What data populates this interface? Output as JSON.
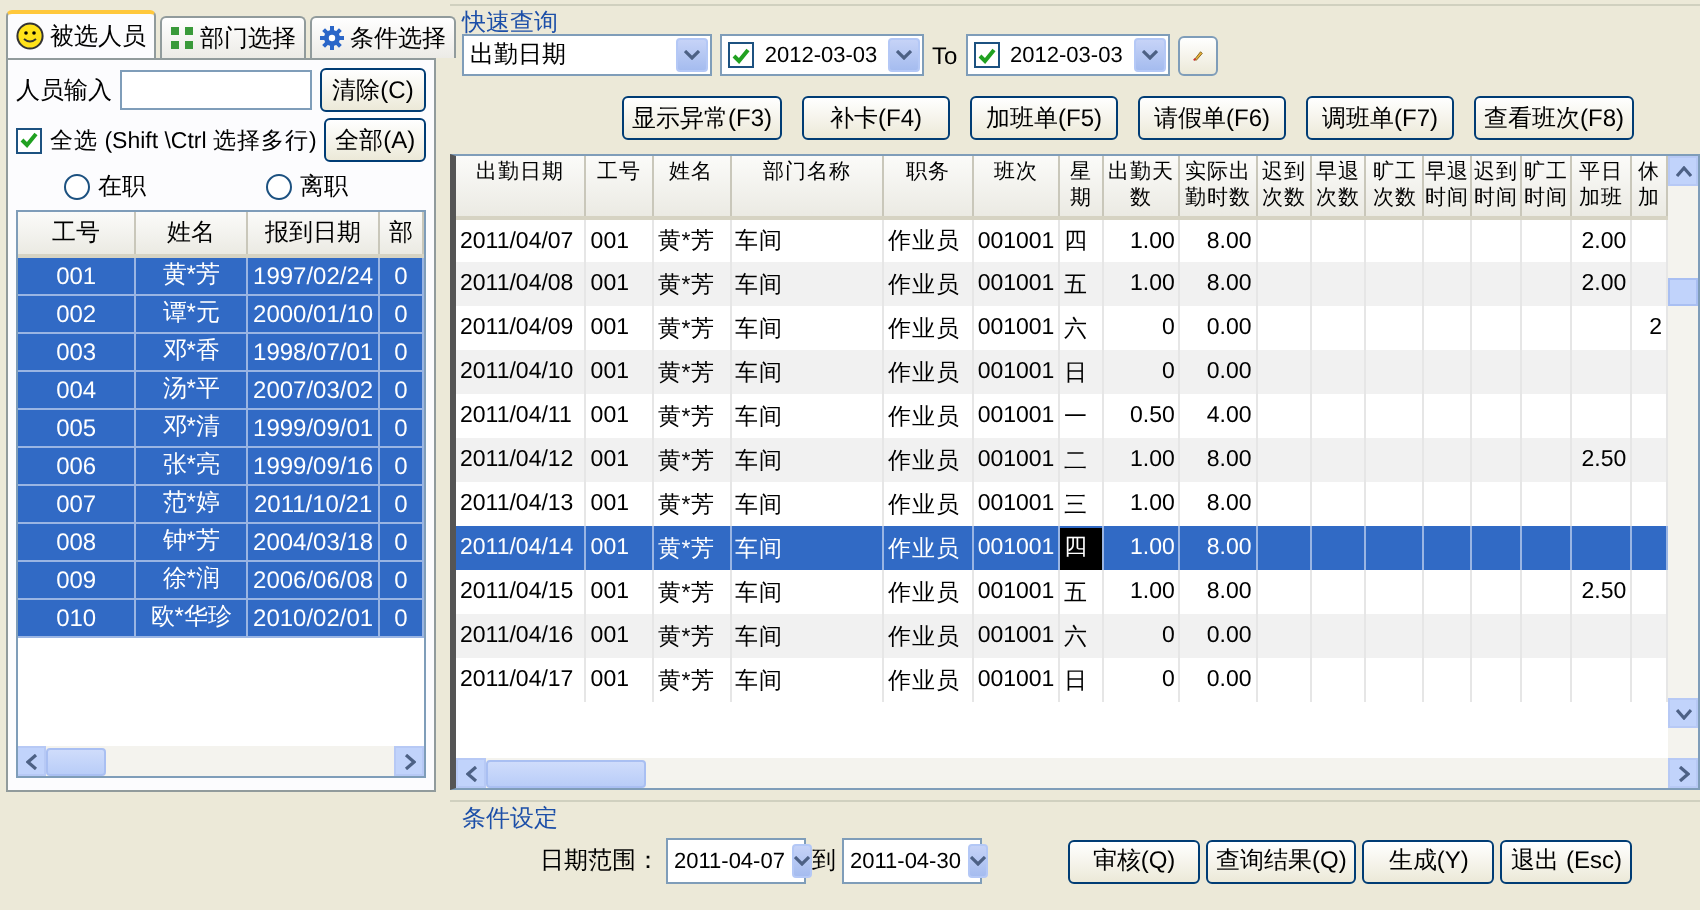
{
  "left_panel": {
    "tabs": [
      {
        "label": "被选人员",
        "selected": true
      },
      {
        "label": "部门选择",
        "selected": false
      },
      {
        "label": "条件选择",
        "selected": false
      }
    ],
    "person_input_label": "人员输入",
    "clear_button": "清除(C)",
    "all_button": "全部(A)",
    "select_all": {
      "label": "全选 (Shift \\Ctrl 选择多行)",
      "checked": true
    },
    "status_radios": [
      {
        "label": "在职",
        "selected": false
      },
      {
        "label": "离职",
        "selected": false
      }
    ],
    "table": {
      "columns": [
        "工号",
        "姓名",
        "报到日期",
        "部"
      ],
      "rows": [
        {
          "cells": [
            "001",
            "黄*芳",
            "1997/02/24",
            "0"
          ],
          "selected": true
        },
        {
          "cells": [
            "002",
            "谭*元",
            "2000/01/10",
            "0"
          ],
          "selected": true
        },
        {
          "cells": [
            "003",
            "邓*香",
            "1998/07/01",
            "0"
          ],
          "selected": true
        },
        {
          "cells": [
            "004",
            "汤*平",
            "2007/03/02",
            "0"
          ],
          "selected": true
        },
        {
          "cells": [
            "005",
            "邓*清",
            "1999/09/01",
            "0"
          ],
          "selected": true
        },
        {
          "cells": [
            "006",
            "张*亮",
            "1999/09/16",
            "0"
          ],
          "selected": true
        },
        {
          "cells": [
            "007",
            "范*婷",
            "2011/10/21",
            "0"
          ],
          "selected": true
        },
        {
          "cells": [
            "008",
            "钟*芳",
            "2004/03/18",
            "0"
          ],
          "selected": true
        },
        {
          "cells": [
            "009",
            "徐*润",
            "2006/06/08",
            "0"
          ],
          "selected": true
        },
        {
          "cells": [
            "010",
            "欧*华珍",
            "2010/02/01",
            "0"
          ],
          "selected": true
        }
      ]
    }
  },
  "quick_query": {
    "title": "快速查询",
    "field": "出勤日期",
    "from": {
      "checked": true,
      "value": "2012-03-03"
    },
    "to_label": "To",
    "to": {
      "checked": true,
      "value": "2012-03-03"
    }
  },
  "action_buttons": [
    "显示异常(F3)",
    "补卡(F4)",
    "加班单(F5)",
    "请假单(F6)",
    "调班单(F7)",
    "查看班次(F8)"
  ],
  "table": {
    "columns": [
      "出勤日期",
      "工号",
      "姓名",
      "部门名称",
      "职务",
      "班次",
      "星期",
      "出勤天数",
      "实际出勤时数",
      "迟到次数",
      "早退次数",
      "旷工次数",
      "早退时间",
      "迟到时间",
      "旷工时间",
      "平日加班",
      "休加"
    ],
    "rows": [
      {
        "cells": [
          "2011/04/07",
          "001",
          "黄*芳",
          "车间",
          "作业员",
          "001001",
          "四",
          "1.00",
          "8.00",
          "",
          "",
          "",
          "",
          "",
          "",
          "2.00",
          ""
        ],
        "selected": false
      },
      {
        "cells": [
          "2011/04/08",
          "001",
          "黄*芳",
          "车间",
          "作业员",
          "001001",
          "五",
          "1.00",
          "8.00",
          "",
          "",
          "",
          "",
          "",
          "",
          "2.00",
          ""
        ],
        "selected": false
      },
      {
        "cells": [
          "2011/04/09",
          "001",
          "黄*芳",
          "车间",
          "作业员",
          "001001",
          "六",
          "0",
          "0.00",
          "",
          "",
          "",
          "",
          "",
          "",
          "",
          "2"
        ],
        "selected": false
      },
      {
        "cells": [
          "2011/04/10",
          "001",
          "黄*芳",
          "车间",
          "作业员",
          "001001",
          "日",
          "0",
          "0.00",
          "",
          "",
          "",
          "",
          "",
          "",
          "",
          ""
        ],
        "selected": false
      },
      {
        "cells": [
          "2011/04/11",
          "001",
          "黄*芳",
          "车间",
          "作业员",
          "001001",
          "一",
          "0.50",
          "4.00",
          "",
          "",
          "",
          "",
          "",
          "",
          "",
          ""
        ],
        "selected": false
      },
      {
        "cells": [
          "2011/04/12",
          "001",
          "黄*芳",
          "车间",
          "作业员",
          "001001",
          "二",
          "1.00",
          "8.00",
          "",
          "",
          "",
          "",
          "",
          "",
          "2.50",
          ""
        ],
        "selected": false
      },
      {
        "cells": [
          "2011/04/13",
          "001",
          "黄*芳",
          "车间",
          "作业员",
          "001001",
          "三",
          "1.00",
          "8.00",
          "",
          "",
          "",
          "",
          "",
          "",
          "",
          ""
        ],
        "selected": false
      },
      {
        "cells": [
          "2011/04/14",
          "001",
          "黄*芳",
          "车间",
          "作业员",
          "001001",
          "四",
          "1.00",
          "8.00",
          "",
          "",
          "",
          "",
          "",
          "",
          "",
          ""
        ],
        "selected": true,
        "cell_focused": true
      },
      {
        "cells": [
          "2011/04/15",
          "001",
          "黄*芳",
          "车间",
          "作业员",
          "001001",
          "五",
          "1.00",
          "8.00",
          "",
          "",
          "",
          "",
          "",
          "",
          "2.50",
          ""
        ],
        "selected": false
      },
      {
        "cells": [
          "2011/04/16",
          "001",
          "黄*芳",
          "车间",
          "作业员",
          "001001",
          "六",
          "0",
          "0.00",
          "",
          "",
          "",
          "",
          "",
          "",
          "",
          ""
        ],
        "selected": false
      },
      {
        "cells": [
          "2011/04/17",
          "001",
          "黄*芳",
          "车间",
          "作业员",
          "001001",
          "日",
          "0",
          "0.00",
          "",
          "",
          "",
          "",
          "",
          "",
          "",
          ""
        ],
        "selected": false
      }
    ]
  },
  "conditions": {
    "title": "条件设定",
    "date_range_label": "日期范围：",
    "from": "2011-04-07",
    "to_label": "到",
    "to": "2011-04-30"
  },
  "bottom_buttons": [
    "审核(Q)",
    "查询结果(Q)",
    "生成(Y)",
    "退出 (Esc)"
  ]
}
